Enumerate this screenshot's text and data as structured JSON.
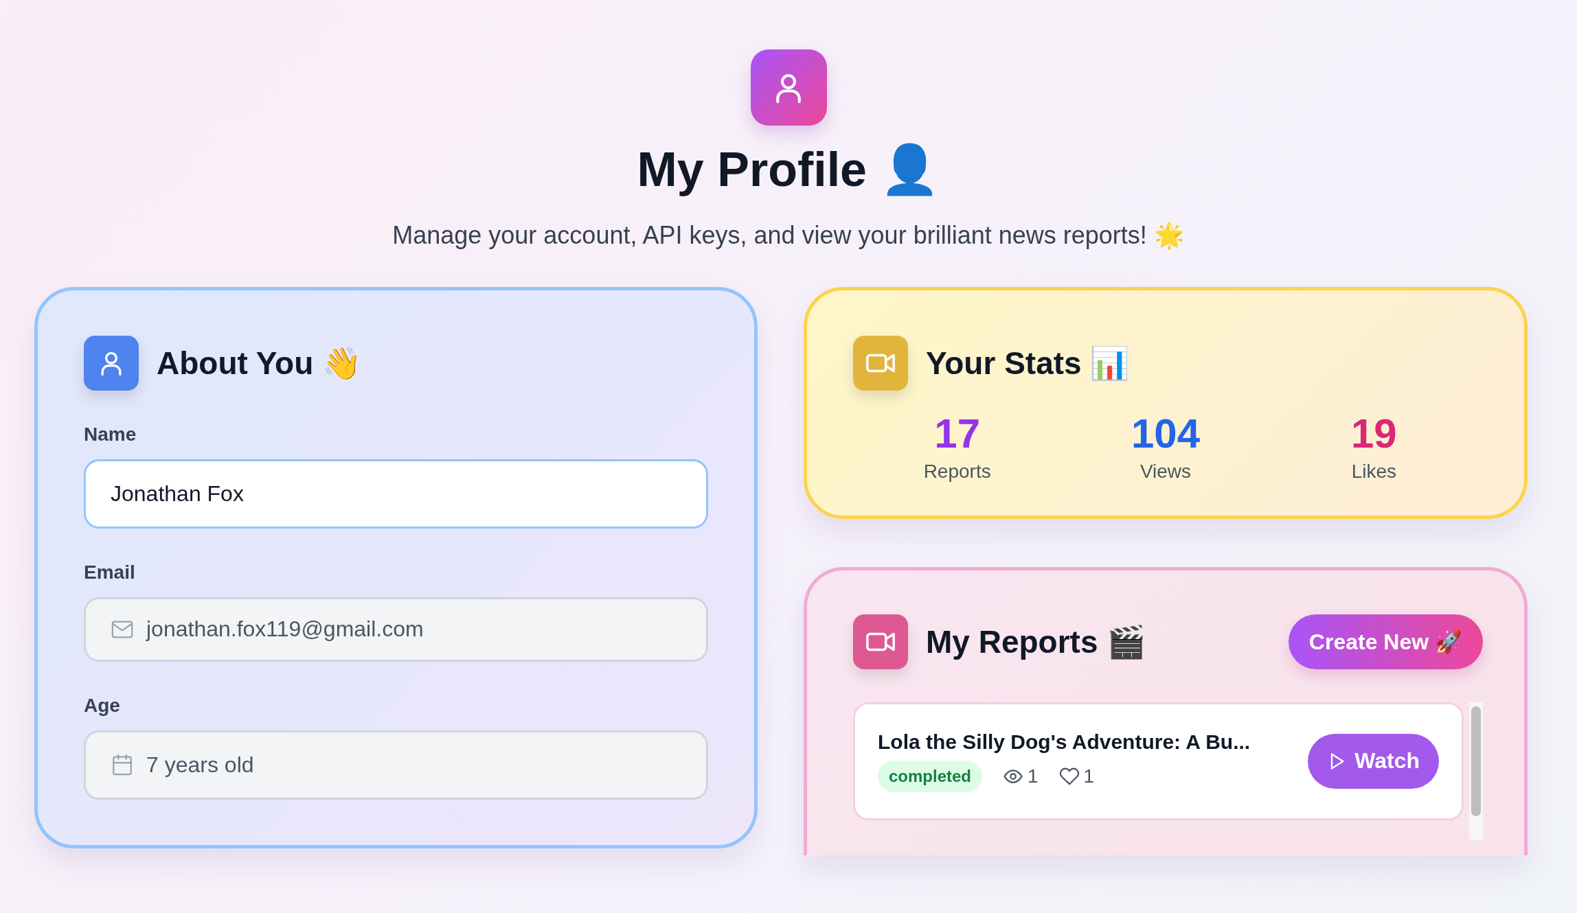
{
  "header": {
    "title": "My Profile 👤",
    "subtitle": "Manage your account, API keys, and view your brilliant news reports! 🌟"
  },
  "about": {
    "title": "About You 👋",
    "fields": [
      {
        "label": "Name",
        "value": "Jonathan Fox",
        "kind": "text",
        "disabled": false
      },
      {
        "label": "Email",
        "value": "jonathan.fox119@gmail.com",
        "kind": "email",
        "disabled": true
      },
      {
        "label": "Age",
        "value": "7 years old",
        "kind": "age",
        "disabled": true
      }
    ]
  },
  "stats": {
    "title": "Your Stats 📊",
    "items": [
      {
        "value": "17",
        "label": "Reports",
        "color": "#9333ea"
      },
      {
        "value": "104",
        "label": "Views",
        "color": "#2563eb"
      },
      {
        "value": "19",
        "label": "Likes",
        "color": "#db2777"
      }
    ]
  },
  "reports": {
    "title": "My Reports 🎬",
    "create_button": "Create New 🚀",
    "items": [
      {
        "title": "Lola the Silly Dog's Adventure: A Bu...",
        "status": "completed",
        "views": "1",
        "likes": "1",
        "action": "Watch"
      }
    ]
  }
}
